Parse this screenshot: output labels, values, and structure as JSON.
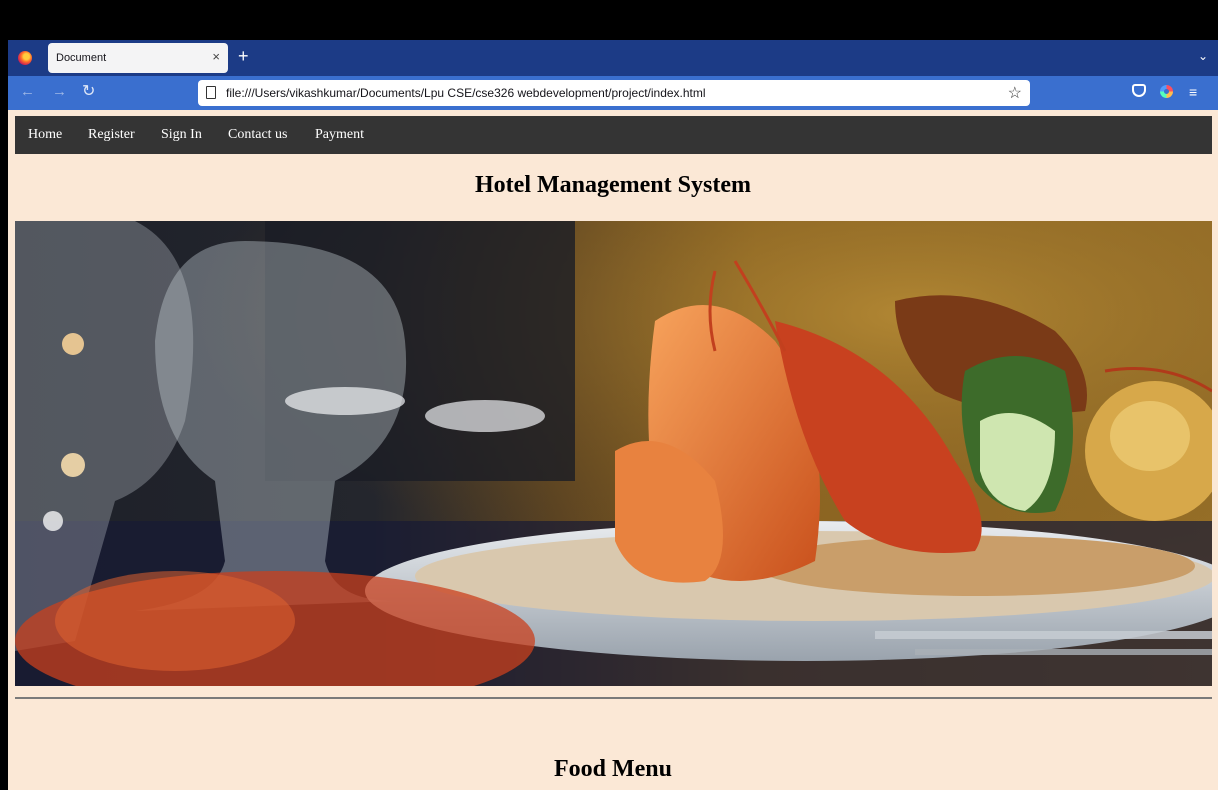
{
  "browser": {
    "tab_title": "Document",
    "tab_close": "×",
    "new_tab": "+",
    "tab_list": "⌄",
    "url": "file:///Users/vikashkumar/Documents/Lpu CSE/cse326 webdevelopment/project/index.html",
    "back": "←",
    "forward": "→",
    "reload": "↻",
    "bookmark": "☆",
    "menu": "≡"
  },
  "site": {
    "nav": [
      "Home",
      "Register",
      "Sign In",
      "Contact us",
      "Payment"
    ],
    "title": "Hotel Management System",
    "section_title": "Food Menu"
  },
  "colors": {
    "tabstrip": "#1c3b86",
    "navbar": "#3a6fcf",
    "page_bg": "#fbe8d6",
    "site_nav_bg": "#343434"
  }
}
